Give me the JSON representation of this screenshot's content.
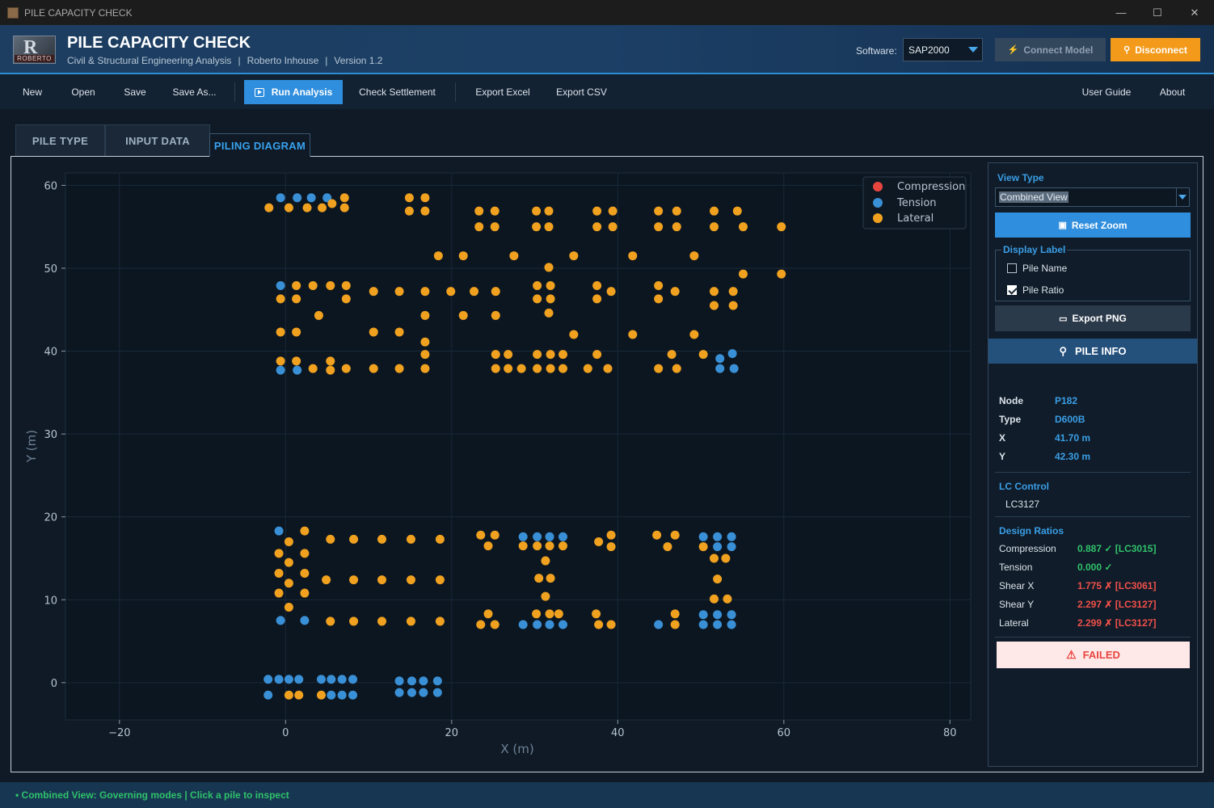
{
  "window": {
    "title": "PILE CAPACITY CHECK",
    "minimize": "—",
    "maximize": "☐",
    "close": "✕"
  },
  "header": {
    "title": "PILE CAPACITY CHECK",
    "subtitle_parts": [
      "Civil & Structural Engineering Analysis",
      "Roberto Inhouse",
      "Version 1.2"
    ],
    "separator": "|",
    "logo_text": "ROBERTO",
    "logo_glyph": "R",
    "software_label": "Software:",
    "software_value": "SAP2000",
    "connect_label": "Connect Model",
    "disconnect_label": "Disconnect",
    "connect_icon": "bolt-icon",
    "disconnect_icon": "pin-icon"
  },
  "toolbar": {
    "new": "New",
    "open": "Open",
    "save": "Save",
    "save_as": "Save As...",
    "run": "Run Analysis",
    "check_settlement": "Check Settlement",
    "export_excel": "Export Excel",
    "export_csv": "Export CSV",
    "user_guide": "User Guide",
    "about": "About"
  },
  "tabs": [
    {
      "label": "PILE TYPE",
      "active": false
    },
    {
      "label": "INPUT DATA",
      "active": false
    },
    {
      "label": "PILING DIAGRAM",
      "active": true
    }
  ],
  "colors": {
    "compression": "#e8453f",
    "tension": "#3a90d6",
    "lateral": "#f0a11f",
    "accent": "#2f8ede",
    "ok": "#2fc26a",
    "fail": "#f0504a"
  },
  "chart_data": {
    "type": "scatter",
    "xlabel": "X (m)",
    "ylabel": "Y (m)",
    "xlim": [
      -26.5,
      82.5
    ],
    "ylim": [
      -4.5,
      61.5
    ],
    "xticks": [
      -20,
      0,
      20,
      40,
      60,
      80
    ],
    "yticks": [
      0,
      10,
      20,
      30,
      40,
      50,
      60
    ],
    "xtick_labels": [
      "−20",
      "0",
      "20",
      "40",
      "60",
      "80"
    ],
    "ytick_labels": [
      "0",
      "10",
      "20",
      "30",
      "40",
      "50",
      "60"
    ],
    "grid": true,
    "legend_placement": "top-right",
    "series": [
      {
        "name": "Compression",
        "color": "#e8453f",
        "points": []
      },
      {
        "name": "Tension",
        "color": "#3a90d6",
        "points": [
          [
            -0.6,
            58.5
          ],
          [
            1.4,
            58.5
          ],
          [
            3.1,
            58.5
          ],
          [
            5.0,
            58.5
          ],
          [
            -0.6,
            47.9
          ],
          [
            -0.6,
            37.7
          ],
          [
            1.4,
            37.7
          ],
          [
            52.3,
            37.9
          ],
          [
            54.0,
            37.9
          ],
          [
            53.8,
            39.7
          ],
          [
            52.3,
            39.1
          ],
          [
            -0.8,
            18.3
          ],
          [
            -0.6,
            7.5
          ],
          [
            2.3,
            7.5
          ],
          [
            28.6,
            17.6
          ],
          [
            30.3,
            17.6
          ],
          [
            31.8,
            17.6
          ],
          [
            33.4,
            17.6
          ],
          [
            28.6,
            7.0
          ],
          [
            30.3,
            7.0
          ],
          [
            31.8,
            7.0
          ],
          [
            33.4,
            7.0
          ],
          [
            50.3,
            17.6
          ],
          [
            52.0,
            17.6
          ],
          [
            53.7,
            17.6
          ],
          [
            52.0,
            16.4
          ],
          [
            53.7,
            16.4
          ],
          [
            50.3,
            8.2
          ],
          [
            52.0,
            8.2
          ],
          [
            53.7,
            8.2
          ],
          [
            50.3,
            7.0
          ],
          [
            52.0,
            7.0
          ],
          [
            53.7,
            7.0
          ],
          [
            44.9,
            7.0
          ],
          [
            -2.1,
            0.4
          ],
          [
            -0.8,
            0.4
          ],
          [
            0.4,
            0.4
          ],
          [
            1.6,
            0.4
          ],
          [
            -2.1,
            -1.5
          ],
          [
            4.3,
            0.4
          ],
          [
            5.5,
            0.4
          ],
          [
            6.8,
            0.4
          ],
          [
            8.1,
            0.4
          ],
          [
            5.5,
            -1.5
          ],
          [
            6.8,
            -1.5
          ],
          [
            8.1,
            -1.5
          ],
          [
            13.7,
            0.2
          ],
          [
            15.2,
            0.2
          ],
          [
            16.6,
            0.2
          ],
          [
            18.3,
            0.2
          ],
          [
            13.7,
            -1.2
          ],
          [
            15.2,
            -1.2
          ],
          [
            16.6,
            -1.2
          ],
          [
            18.3,
            -1.2
          ]
        ]
      },
      {
        "name": "Lateral",
        "color": "#f0a11f",
        "points": [
          [
            7.1,
            58.5
          ],
          [
            -2.0,
            57.3
          ],
          [
            0.4,
            57.3
          ],
          [
            2.6,
            57.3
          ],
          [
            4.4,
            57.3
          ],
          [
            5.6,
            57.8
          ],
          [
            7.1,
            57.3
          ],
          [
            14.9,
            58.5
          ],
          [
            16.8,
            58.5
          ],
          [
            14.9,
            56.9
          ],
          [
            16.8,
            56.9
          ],
          [
            23.3,
            56.9
          ],
          [
            25.2,
            56.9
          ],
          [
            23.3,
            55.0
          ],
          [
            25.2,
            55.0
          ],
          [
            30.2,
            56.9
          ],
          [
            31.7,
            56.9
          ],
          [
            30.2,
            55.0
          ],
          [
            31.7,
            55.0
          ],
          [
            37.5,
            56.9
          ],
          [
            39.4,
            56.9
          ],
          [
            37.5,
            55.0
          ],
          [
            39.4,
            55.0
          ],
          [
            44.9,
            56.9
          ],
          [
            47.1,
            56.9
          ],
          [
            44.9,
            55.0
          ],
          [
            47.1,
            55.0
          ],
          [
            51.6,
            56.9
          ],
          [
            54.4,
            56.9
          ],
          [
            51.6,
            55.0
          ],
          [
            55.1,
            55.0
          ],
          [
            59.7,
            55.0
          ],
          [
            18.4,
            51.5
          ],
          [
            21.4,
            51.5
          ],
          [
            27.5,
            51.5
          ],
          [
            34.7,
            51.5
          ],
          [
            41.8,
            51.5
          ],
          [
            49.2,
            51.5
          ],
          [
            31.7,
            50.1
          ],
          [
            55.1,
            49.3
          ],
          [
            59.7,
            49.3
          ],
          [
            1.3,
            47.9
          ],
          [
            3.3,
            47.9
          ],
          [
            5.4,
            47.9
          ],
          [
            7.3,
            47.9
          ],
          [
            10.6,
            47.2
          ],
          [
            13.7,
            47.2
          ],
          [
            16.8,
            47.2
          ],
          [
            19.9,
            47.2
          ],
          [
            22.7,
            47.2
          ],
          [
            25.3,
            47.2
          ],
          [
            30.3,
            47.9
          ],
          [
            31.9,
            47.9
          ],
          [
            37.5,
            47.9
          ],
          [
            39.2,
            47.2
          ],
          [
            44.9,
            47.9
          ],
          [
            46.9,
            47.2
          ],
          [
            51.6,
            47.2
          ],
          [
            53.9,
            47.2
          ],
          [
            -0.6,
            46.3
          ],
          [
            1.3,
            46.3
          ],
          [
            7.3,
            46.3
          ],
          [
            30.3,
            46.3
          ],
          [
            31.9,
            46.3
          ],
          [
            37.5,
            46.3
          ],
          [
            44.9,
            46.3
          ],
          [
            51.6,
            45.5
          ],
          [
            53.9,
            45.5
          ],
          [
            4.0,
            44.3
          ],
          [
            16.8,
            44.3
          ],
          [
            21.4,
            44.3
          ],
          [
            25.3,
            44.3
          ],
          [
            31.7,
            44.6
          ],
          [
            -0.6,
            42.3
          ],
          [
            1.3,
            42.3
          ],
          [
            10.6,
            42.3
          ],
          [
            13.7,
            42.3
          ],
          [
            34.7,
            42.0
          ],
          [
            41.8,
            42.0
          ],
          [
            49.2,
            42.0
          ],
          [
            16.8,
            41.1
          ],
          [
            16.8,
            39.6
          ],
          [
            25.3,
            39.6
          ],
          [
            26.8,
            39.6
          ],
          [
            30.3,
            39.6
          ],
          [
            31.9,
            39.6
          ],
          [
            33.4,
            39.6
          ],
          [
            37.5,
            39.6
          ],
          [
            46.5,
            39.6
          ],
          [
            50.3,
            39.6
          ],
          [
            -0.6,
            38.8
          ],
          [
            1.3,
            38.8
          ],
          [
            5.4,
            38.8
          ],
          [
            3.3,
            37.9
          ],
          [
            7.3,
            37.9
          ],
          [
            5.4,
            37.7
          ],
          [
            10.6,
            37.9
          ],
          [
            13.7,
            37.9
          ],
          [
            16.8,
            37.9
          ],
          [
            25.3,
            37.9
          ],
          [
            26.8,
            37.9
          ],
          [
            28.4,
            37.9
          ],
          [
            30.3,
            37.9
          ],
          [
            31.9,
            37.9
          ],
          [
            33.4,
            37.9
          ],
          [
            36.4,
            37.9
          ],
          [
            38.8,
            37.9
          ],
          [
            44.9,
            37.9
          ],
          [
            47.1,
            37.9
          ],
          [
            2.3,
            18.3
          ],
          [
            0.4,
            17.0
          ],
          [
            2.3,
            15.6
          ],
          [
            -0.8,
            15.6
          ],
          [
            0.4,
            14.5
          ],
          [
            2.3,
            13.2
          ],
          [
            -0.8,
            13.2
          ],
          [
            0.4,
            12.0
          ],
          [
            -0.8,
            10.8
          ],
          [
            2.3,
            10.8
          ],
          [
            0.4,
            9.1
          ],
          [
            5.4,
            17.3
          ],
          [
            8.2,
            17.3
          ],
          [
            11.6,
            17.3
          ],
          [
            15.1,
            17.3
          ],
          [
            18.6,
            17.3
          ],
          [
            4.9,
            12.4
          ],
          [
            8.2,
            12.4
          ],
          [
            11.6,
            12.4
          ],
          [
            15.1,
            12.4
          ],
          [
            18.6,
            12.4
          ],
          [
            5.4,
            7.4
          ],
          [
            8.2,
            7.4
          ],
          [
            11.6,
            7.4
          ],
          [
            15.1,
            7.4
          ],
          [
            18.6,
            7.4
          ],
          [
            23.5,
            17.8
          ],
          [
            25.2,
            17.8
          ],
          [
            24.4,
            16.5
          ],
          [
            28.6,
            16.5
          ],
          [
            30.3,
            16.5
          ],
          [
            31.8,
            16.5
          ],
          [
            33.4,
            16.5
          ],
          [
            31.3,
            14.7
          ],
          [
            30.5,
            12.6
          ],
          [
            31.9,
            12.6
          ],
          [
            31.3,
            10.4
          ],
          [
            30.2,
            8.3
          ],
          [
            31.8,
            8.3
          ],
          [
            32.9,
            8.3
          ],
          [
            37.4,
            8.3
          ],
          [
            24.4,
            8.3
          ],
          [
            46.9,
            8.3
          ],
          [
            23.5,
            7.0
          ],
          [
            25.2,
            7.0
          ],
          [
            37.7,
            7.0
          ],
          [
            39.2,
            7.0
          ],
          [
            46.9,
            7.0
          ],
          [
            37.7,
            17.0
          ],
          [
            39.2,
            17.8
          ],
          [
            39.2,
            16.4
          ],
          [
            44.7,
            17.8
          ],
          [
            46.9,
            17.8
          ],
          [
            46.0,
            16.4
          ],
          [
            50.3,
            16.4
          ],
          [
            51.6,
            15.0
          ],
          [
            53.0,
            15.0
          ],
          [
            52.0,
            12.5
          ],
          [
            51.6,
            10.1
          ],
          [
            53.2,
            10.1
          ],
          [
            0.4,
            -1.5
          ],
          [
            1.6,
            -1.5
          ],
          [
            4.3,
            -1.5
          ]
        ]
      }
    ]
  },
  "side_panel": {
    "view_type_title": "View Type",
    "view_type_value": "Combined View",
    "reset_zoom": "Reset Zoom",
    "display_label_title": "Display Label",
    "pile_name_label": "Pile Name",
    "pile_name_checked": false,
    "pile_ratio_label": "Pile Ratio",
    "pile_ratio_checked": true,
    "export_png": "Export PNG",
    "pile_info_title": "PILE INFO",
    "info": [
      {
        "key": "Node",
        "value": "P182"
      },
      {
        "key": "Type",
        "value": "D600B"
      },
      {
        "key": "X",
        "value": "41.70 m"
      },
      {
        "key": "Y",
        "value": "42.30 m"
      }
    ],
    "lc_control_title": "LC Control",
    "lc_control_value": "LC3127",
    "design_ratios_title": "Design Ratios",
    "ratios": [
      {
        "key": "Compression",
        "value": "0.887 ✓  [LC3015]",
        "status": "ok"
      },
      {
        "key": "Tension",
        "value": "0.000 ✓",
        "status": "ok"
      },
      {
        "key": "Shear X",
        "value": "1.775  ✗  [LC3061]",
        "status": "bad"
      },
      {
        "key": "Shear Y",
        "value": "2.297  ✗  [LC3127]",
        "status": "bad"
      },
      {
        "key": "Lateral",
        "value": "2.299  ✗  [LC3127]",
        "status": "bad"
      }
    ],
    "result": "FAILED"
  },
  "status": {
    "text": "• Combined View: Governing modes | Click a pile to inspect"
  }
}
